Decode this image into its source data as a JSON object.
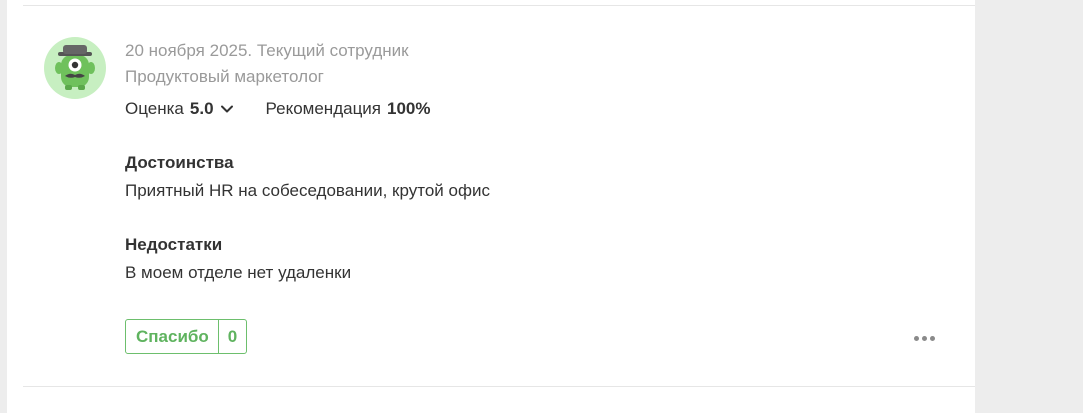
{
  "review": {
    "date_status": "20 ноября 2025. Текущий сотрудник",
    "position": "Продуктовый маркетолог",
    "rating_label": "Оценка",
    "rating_value": "5.0",
    "recommend_label": "Рекомендация",
    "recommend_value": "100%",
    "pros_title": "Достоинства",
    "pros_text": "Приятный HR на собеседовании, крутой офис",
    "cons_title": "Недостатки",
    "cons_text": "В моем отделе нет удаленки",
    "thanks_label": "Спасибо",
    "thanks_count": "0"
  },
  "icons": {
    "avatar": "monster-avatar-icon",
    "rating_toggle": "chevron-down-icon",
    "more": "more-dots-icon"
  },
  "colors": {
    "accent_green": "#5fb35f",
    "avatar_bg": "#c7efc1",
    "muted_text": "#9a9a9a"
  }
}
